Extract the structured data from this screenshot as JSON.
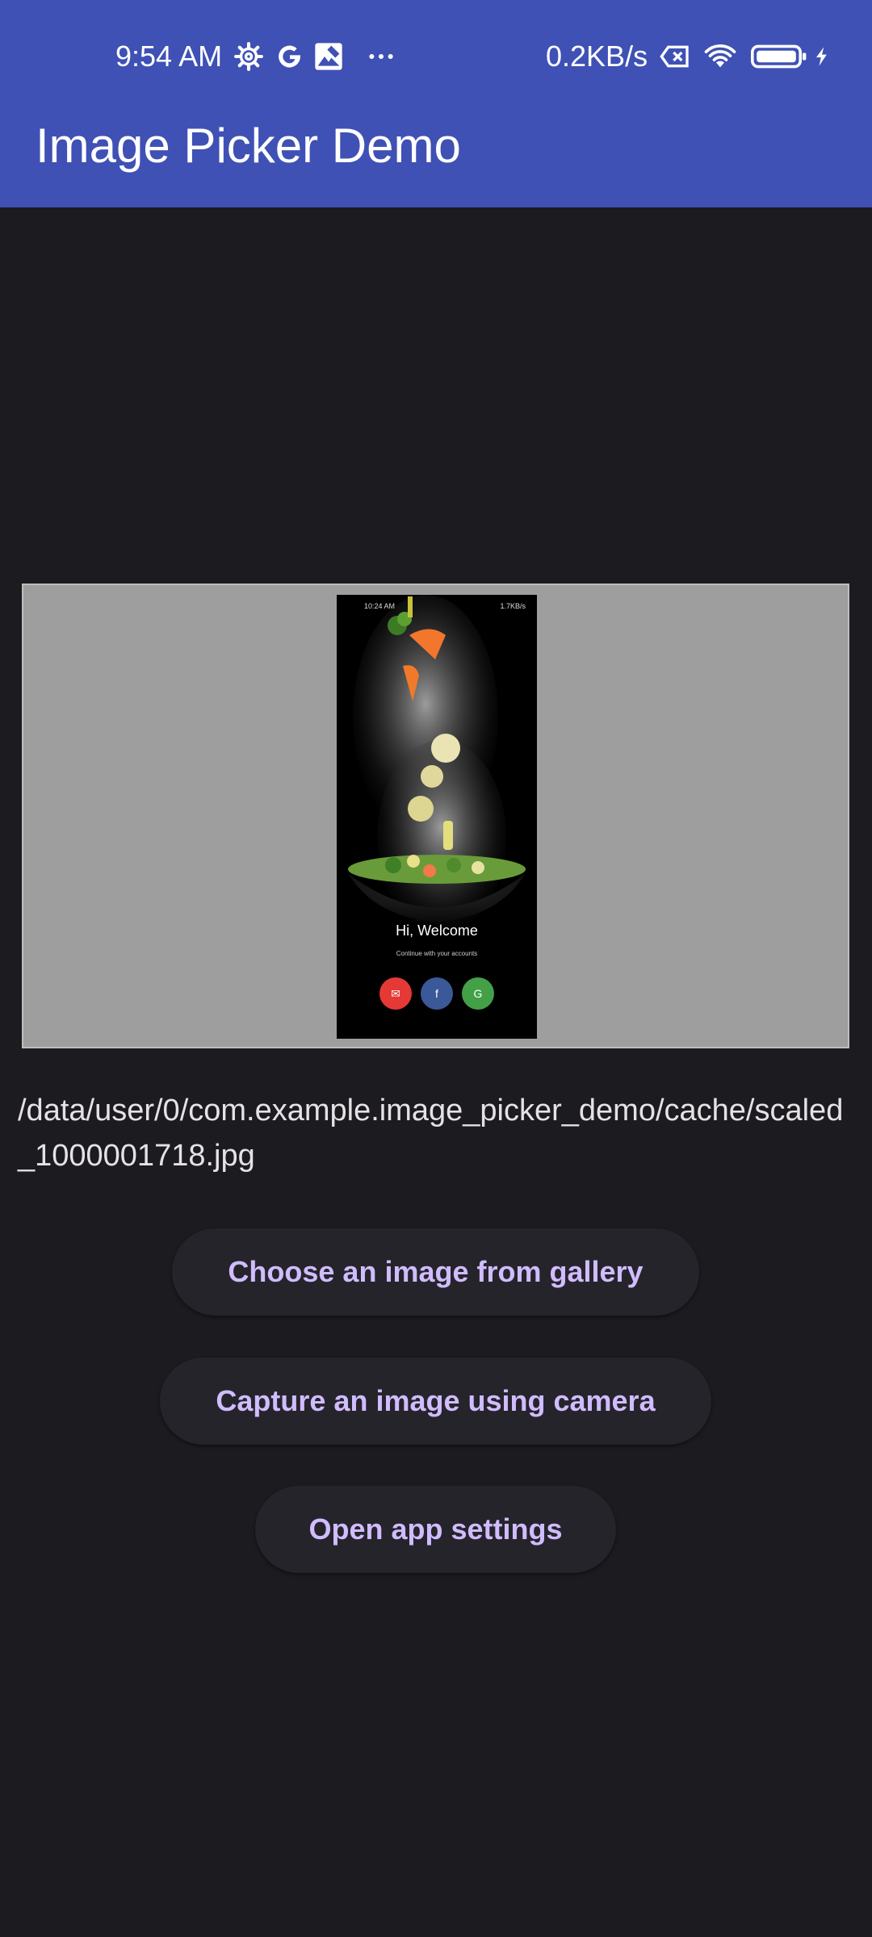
{
  "status_bar": {
    "time": "9:54 AM",
    "network_speed": "0.2KB/s",
    "icons": [
      "settings-gear-icon",
      "google-g-icon",
      "photos-icon",
      "more-dots-icon",
      "no-sim-icon",
      "wifi-icon",
      "battery-icon",
      "charging-bolt-icon"
    ]
  },
  "app_bar": {
    "title": "Image Picker Demo",
    "color": "#3f51b5"
  },
  "preview": {
    "status_time": "10:24 AM",
    "status_speed": "1.7KB/s",
    "greeting": "Hi, Welcome",
    "subtitle": "Continue with your accounts",
    "buttons": [
      {
        "icon": "mail-icon",
        "color": "#e53935"
      },
      {
        "icon": "facebook-icon",
        "color": "#3b5998"
      },
      {
        "icon": "google-icon",
        "color": "#43a047"
      }
    ]
  },
  "file_path": "/data/user/0/com.example.image_picker_demo/cache/scaled_1000001718.jpg",
  "actions": {
    "gallery": "Choose an image from gallery",
    "camera": "Capture an image using camera",
    "settings": "Open app settings"
  },
  "colors": {
    "background": "#1c1b1f",
    "button_text": "#d0bcff",
    "button_bg": "#26242b"
  }
}
